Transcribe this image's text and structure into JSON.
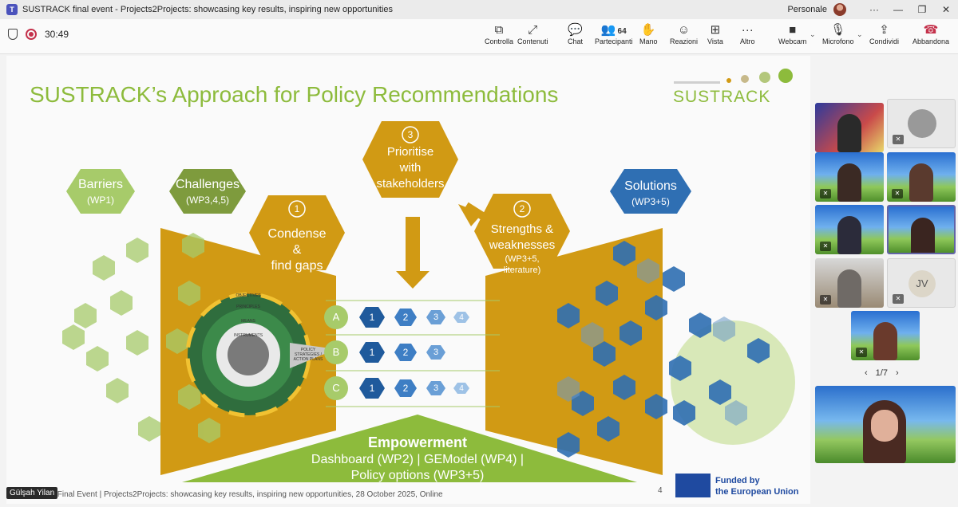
{
  "window": {
    "title": "SUSTRACK final event - Projects2Projects: showcasing key results, inspiring new opportunities",
    "profile": "Personale"
  },
  "toolbar": {
    "timer": "30:49",
    "items": [
      {
        "label": "Controlla",
        "icon": "share-control-icon"
      },
      {
        "label": "Contenuti",
        "icon": "content-icon"
      },
      {
        "label": "Chat",
        "icon": "chat-icon"
      },
      {
        "label": "Partecipanti",
        "icon": "people-icon",
        "count": "64"
      },
      {
        "label": "Mano",
        "icon": "raise-hand-icon"
      },
      {
        "label": "Reazioni",
        "icon": "reactions-icon"
      },
      {
        "label": "Vista",
        "icon": "view-icon"
      },
      {
        "label": "Altro",
        "icon": "more-icon"
      },
      {
        "label": "Webcam",
        "icon": "camera-icon"
      },
      {
        "label": "Microfono",
        "icon": "mic-off-icon"
      },
      {
        "label": "Condividi",
        "icon": "share-icon"
      },
      {
        "label": "Abbandona",
        "icon": "leave-icon"
      }
    ]
  },
  "slide": {
    "title": "SUSTRACK’s Approach for Policy Recommendations",
    "logo": "SUSTRACK",
    "barriers": {
      "title": "Barriers",
      "sub": "(WP1)"
    },
    "challenges": {
      "title": "Challenges",
      "sub": "(WP3,4,5)"
    },
    "solutions": {
      "title": "Solutions",
      "sub": "(WP3+5)"
    },
    "step1": {
      "num": "1",
      "line1": "Condense",
      "line2": "&",
      "line3": "find gaps"
    },
    "step2": {
      "num": "2",
      "line1": "Strengths &",
      "line2": "weaknesses",
      "line3": "(WP3+5,",
      "line4": "literature)"
    },
    "step3": {
      "num": "3",
      "line1": "Prioritise",
      "line2": "with",
      "line3": "stakeholders"
    },
    "rows": [
      {
        "letter": "A",
        "items": [
          "1",
          "2",
          "3",
          "4"
        ]
      },
      {
        "letter": "B",
        "items": [
          "1",
          "2",
          "3"
        ]
      },
      {
        "letter": "C",
        "items": [
          "1",
          "2",
          "3",
          "4"
        ]
      }
    ],
    "wheel": {
      "ring": [
        "OBJECTIVES",
        "PRINCIPLES",
        "MEANS",
        "INSTRUMENTS"
      ],
      "center": "POLICY STRATEGIES / ACTION PLANS"
    },
    "empowerment": {
      "title": "Empowerment",
      "line1": "Dashboard (WP2) | GEModel (WP4) |",
      "line2": "Policy options (WP3+5)"
    },
    "footer": "k Final Event | Projects2Projects: showcasing key results, inspiring new opportunities, 28 October 2025, Online",
    "page": "4",
    "eu_line1": "Funded by",
    "eu_line2": "the European Union"
  },
  "speaker_label": "Gülşah Yilan",
  "gallery": {
    "pager": "1/7",
    "initials": "JV"
  },
  "colors": {
    "green": "#8dbb3c",
    "gold": "#d19a14",
    "blue": "#2f6fb3",
    "light_green": "#a7cb6a"
  }
}
